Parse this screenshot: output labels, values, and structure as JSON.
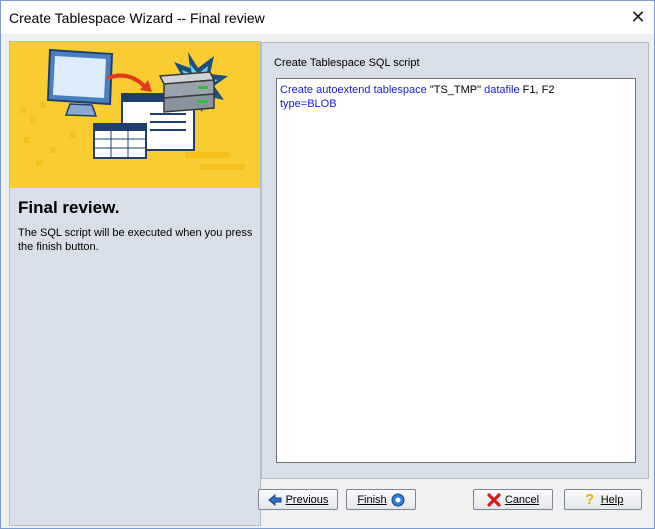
{
  "window": {
    "title": "Create Tablespace Wizard -- Final review",
    "close_glyph": "✕"
  },
  "sidebar": {
    "heading": "Final review.",
    "description": "The SQL script will be executed when you press the finish button."
  },
  "content": {
    "label": "Create Tablespace SQL script",
    "sql": {
      "line1_kw1": "Create autoextend tablespace",
      "line1_str": "\"TS_TMP\"",
      "line1_kw2": "datafile",
      "line1_rest": "F1, F2",
      "line2_kw": "type=BLOB"
    }
  },
  "buttons": {
    "previous": "Previous",
    "finish": "Finish",
    "cancel": "Cancel",
    "help": "Help"
  },
  "colors": {
    "keyword": "#1a1adb",
    "banner": "#f9cc31",
    "panel": "#d8dfe9"
  },
  "icons": {
    "previous": "arrow-left-icon",
    "finish": "finish-icon",
    "cancel": "red-x-icon",
    "help": "question-icon"
  }
}
